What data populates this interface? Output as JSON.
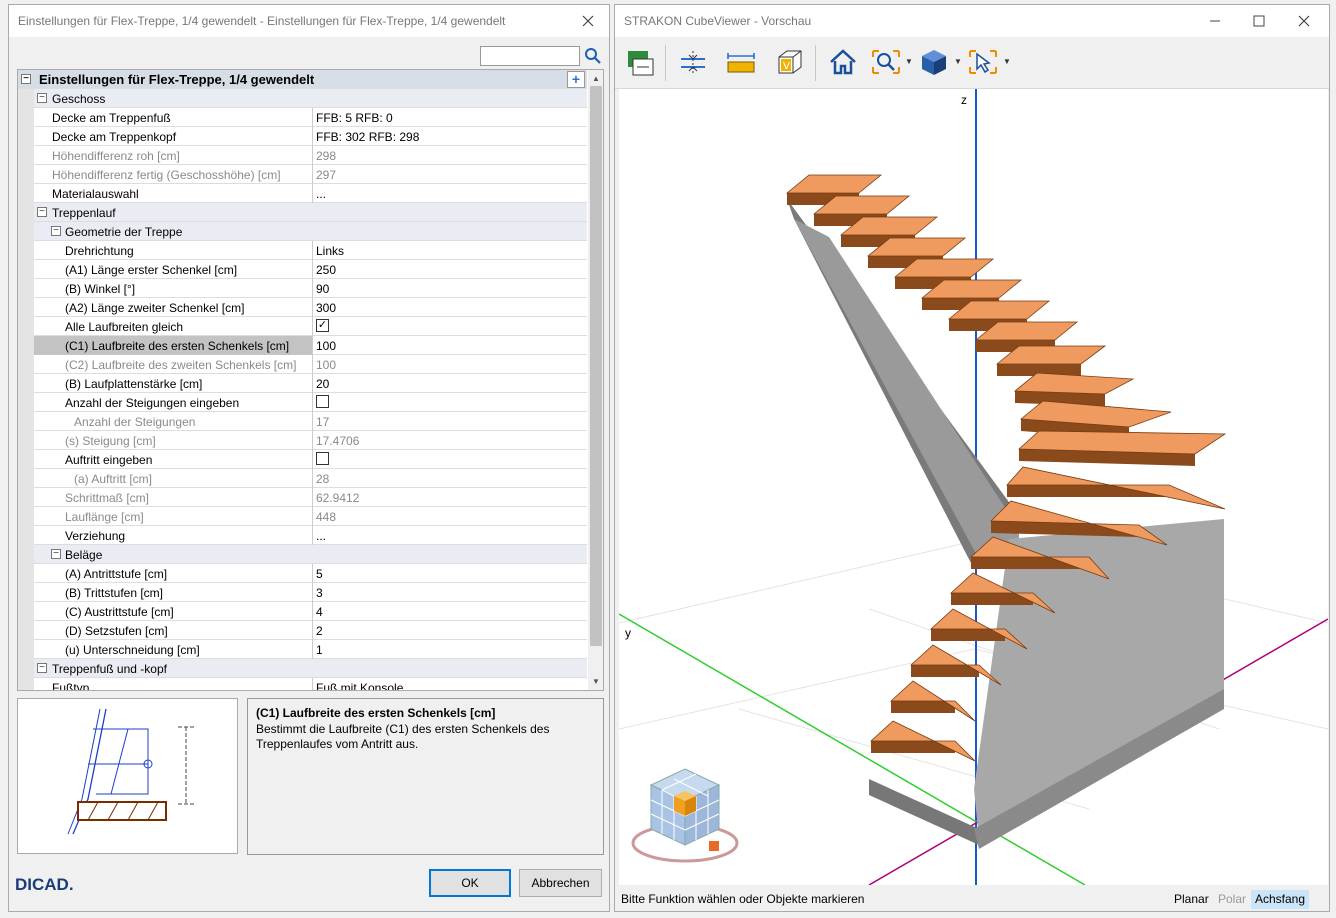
{
  "left_window": {
    "title": "Einstellungen für Flex-Treppe, 1/4 gewendelt - Einstellungen für Flex-Treppe, 1/4 gewendelt",
    "search_value": "",
    "root_title": "Einstellungen für Flex-Treppe, 1/4 gewendelt",
    "rows": [
      {
        "label": "Geschoss",
        "value": "",
        "type": "cat"
      },
      {
        "label": "Decke am Treppenfuß",
        "value": "FFB: 5 RFB: 0"
      },
      {
        "label": "Decke am Treppenkopf",
        "value": "FFB: 302 RFB: 298"
      },
      {
        "label": "Höhendifferenz roh [cm]",
        "value": "298",
        "disabled": true
      },
      {
        "label": "Höhendifferenz fertig (Geschosshöhe) [cm]",
        "value": "297",
        "disabled": true
      },
      {
        "label": "Materialauswahl",
        "value": "..."
      },
      {
        "label": "Treppenlauf",
        "value": "",
        "type": "cat"
      },
      {
        "label": "Geometrie der Treppe",
        "value": "",
        "type": "subcat"
      },
      {
        "label": "Drehrichtung",
        "value": "Links"
      },
      {
        "label": "(A1) Länge erster Schenkel [cm]",
        "value": "250"
      },
      {
        "label": "(B) Winkel [°]",
        "value": "90"
      },
      {
        "label": "(A2) Länge zweiter Schenkel [cm]",
        "value": "300"
      },
      {
        "label": "Alle Laufbreiten gleich",
        "value": "",
        "check": true
      },
      {
        "label": "(C1) Laufbreite des ersten Schenkels [cm]",
        "value": "100",
        "selected": true
      },
      {
        "label": "(C2) Laufbreite des zweiten Schenkels [cm]",
        "value": "100",
        "disabled": true
      },
      {
        "label": "(B) Laufplattenstärke [cm]",
        "value": "20"
      },
      {
        "label": "Anzahl der Steigungen eingeben",
        "value": "",
        "check": false
      },
      {
        "label": "Anzahl der Steigungen",
        "value": "17",
        "disabled": true,
        "indent2": true
      },
      {
        "label": "(s) Steigung [cm]",
        "value": "17.4706",
        "disabled": true
      },
      {
        "label": "Auftritt eingeben",
        "value": "",
        "check": false
      },
      {
        "label": "(a) Auftritt [cm]",
        "value": "28",
        "disabled": true,
        "indent2": true
      },
      {
        "label": "Schrittmaß [cm]",
        "value": "62.9412",
        "disabled": true
      },
      {
        "label": "Lauflänge [cm]",
        "value": "448",
        "disabled": true
      },
      {
        "label": "Verziehung",
        "value": "..."
      },
      {
        "label": "Beläge",
        "value": "",
        "type": "subcat"
      },
      {
        "label": "(A) Antrittstufe [cm]",
        "value": "5"
      },
      {
        "label": "(B) Trittstufen [cm]",
        "value": "3"
      },
      {
        "label": "(C) Austrittstufe [cm]",
        "value": "4"
      },
      {
        "label": "(D) Setzstufen [cm]",
        "value": "2"
      },
      {
        "label": "(u) Unterschneidung [cm]",
        "value": "1"
      },
      {
        "label": "Treppenfuß und -kopf",
        "value": "",
        "type": "cat"
      },
      {
        "label": "Fußtyp",
        "value": "Fuß mit Konsole"
      }
    ],
    "description": {
      "heading": "(C1) Laufbreite des ersten Schenkels [cm]",
      "body": "Bestimmt die Laufbreite (C1) des ersten Schenkels des Treppenlaufes vom Antritt aus."
    },
    "ok_label": "OK",
    "cancel_label": "Abbrechen",
    "logo_text": "DICAD."
  },
  "right_window": {
    "title": "STRAKON CubeViewer - Vorschau",
    "toolbar_icons": [
      "export-icon",
      "section-icon",
      "measure-icon",
      "view-box-icon",
      "home-icon",
      "zoom-icon",
      "render-mode-icon",
      "select-icon"
    ],
    "axis_z": "z",
    "axis_y": "y",
    "status_text": "Bitte Funktion wählen oder Objekte markieren",
    "modes": [
      "Planar",
      "Polar",
      "Achsfang"
    ]
  }
}
